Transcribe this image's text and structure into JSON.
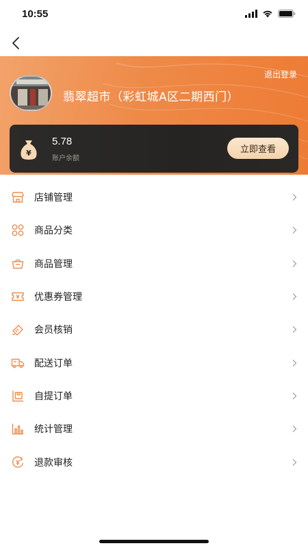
{
  "status_bar": {
    "time": "10:55"
  },
  "header": {
    "logout_label": "退出登录",
    "store_name": "翡翠超市（彩虹城A区二期西门）"
  },
  "balance": {
    "value": "5.78",
    "label": "账户余额",
    "view_button": "立即查看"
  },
  "menu": {
    "items": [
      {
        "label": "店铺管理",
        "icon": "store-icon"
      },
      {
        "label": "商品分类",
        "icon": "category-icon"
      },
      {
        "label": "商品管理",
        "icon": "basket-icon"
      },
      {
        "label": "优惠券管理",
        "icon": "coupon-icon"
      },
      {
        "label": "会员核销",
        "icon": "member-verify-icon"
      },
      {
        "label": "配送订单",
        "icon": "truck-icon"
      },
      {
        "label": "自提订单",
        "icon": "pickup-icon"
      },
      {
        "label": "统计管理",
        "icon": "statistics-icon"
      },
      {
        "label": "退款审核",
        "icon": "refund-icon"
      }
    ]
  },
  "colors": {
    "accent": "#ed7b34",
    "icon_orange": "#ee8d4d",
    "card_dark": "#272624",
    "button_gold": "#f7dcbb"
  }
}
